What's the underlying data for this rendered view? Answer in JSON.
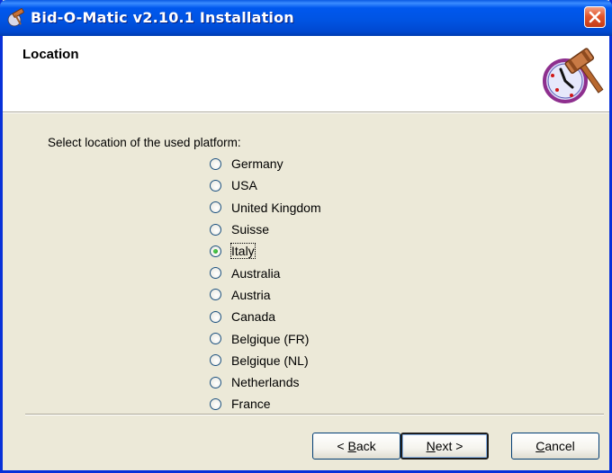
{
  "window": {
    "title": "Bid-O-Matic v2.10.1 Installation"
  },
  "header": {
    "title": "Location"
  },
  "body": {
    "prompt": "Select location of the used platform:"
  },
  "locations": [
    {
      "label": "Germany",
      "checked": false
    },
    {
      "label": "USA",
      "checked": false
    },
    {
      "label": "United Kingdom",
      "checked": false
    },
    {
      "label": "Suisse",
      "checked": false
    },
    {
      "label": "Italy",
      "checked": true
    },
    {
      "label": "Australia",
      "checked": false
    },
    {
      "label": "Austria",
      "checked": false
    },
    {
      "label": "Canada",
      "checked": false
    },
    {
      "label": "Belgique (FR)",
      "checked": false
    },
    {
      "label": "Belgique (NL)",
      "checked": false
    },
    {
      "label": "Netherlands",
      "checked": false
    },
    {
      "label": "France",
      "checked": false
    }
  ],
  "buttons": {
    "back": {
      "prefix": "< ",
      "mnemonic": "B",
      "rest": "ack"
    },
    "next": {
      "mnemonic": "N",
      "rest": "ext >"
    },
    "cancel": {
      "mnemonic": "C",
      "rest": "ancel"
    }
  },
  "icons": {
    "app": "bid-o-matic-app-icon",
    "close": "close-icon",
    "logo": "gavel-clock-logo"
  },
  "colors": {
    "titlebar": "#0054e3",
    "close": "#e2562c",
    "dialog_bg": "#ece9d8",
    "selected_dot": "#21a121"
  }
}
